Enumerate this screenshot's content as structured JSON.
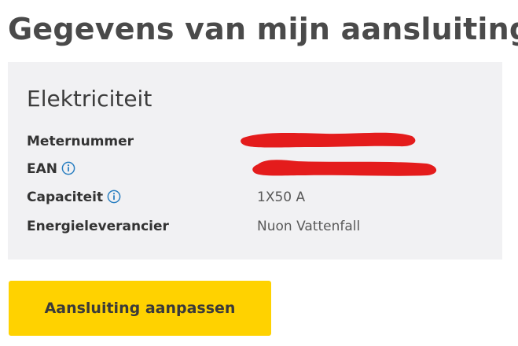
{
  "page_title": "Gegevens van mijn aansluiting",
  "card": {
    "title": "Elektriciteit",
    "rows": [
      {
        "label": "Meternummer",
        "value": "",
        "info_icon": false,
        "redacted": true
      },
      {
        "label": "EAN",
        "value": "",
        "info_icon": true,
        "redacted": true
      },
      {
        "label": "Capaciteit",
        "value": "1X50 A",
        "info_icon": true,
        "redacted": false
      },
      {
        "label": "Energieleverancier",
        "value": "Nuon Vattenfall",
        "info_icon": false,
        "redacted": false
      }
    ]
  },
  "action_button_label": "Aansluiting aanpassen",
  "colors": {
    "card_background": "#f1f1f3",
    "button_background": "#ffd200",
    "info_icon": "#2a7fc1",
    "redaction": "#e41c1c"
  },
  "icons": [
    "info-icon"
  ]
}
